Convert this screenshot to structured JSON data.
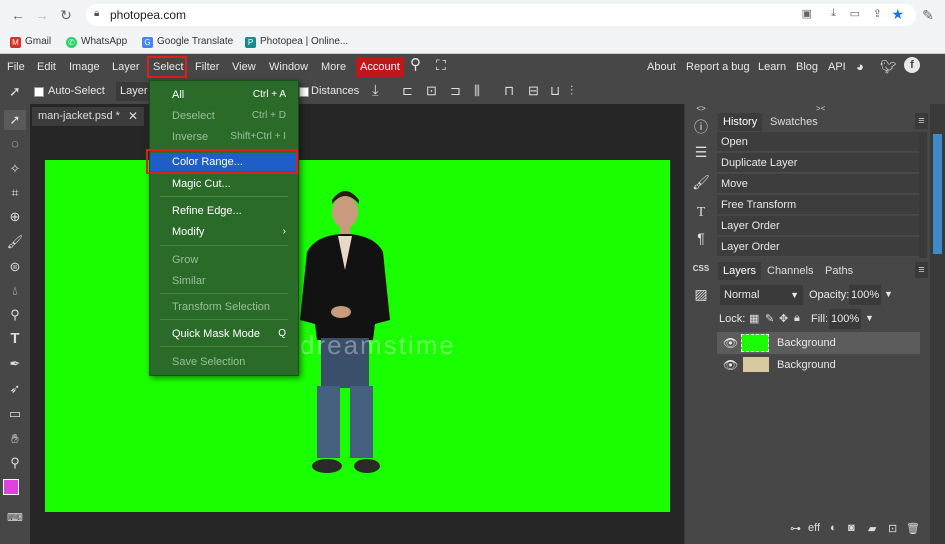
{
  "browser": {
    "url": "photopea.com",
    "bookmarks": [
      {
        "label": "Gmail",
        "color": "#d93025"
      },
      {
        "label": "WhatsApp",
        "color": "#25d366"
      },
      {
        "label": "Google Translate",
        "color": "#4285f4"
      },
      {
        "label": "Photopea | Online...",
        "color": "#1b8a8a"
      }
    ]
  },
  "menubar": {
    "items": [
      "File",
      "Edit",
      "Image",
      "Layer",
      "Select",
      "Filter",
      "View",
      "Window",
      "More",
      "Account"
    ],
    "right_items": [
      "About",
      "Report a bug",
      "Learn",
      "Blog",
      "API"
    ],
    "account_color": "#c0171a"
  },
  "options_bar": {
    "auto_select_label": "Auto-Select",
    "layer_value": "Layer",
    "distances_label": "Distances"
  },
  "document": {
    "tab_title": "man-jacket.psd *",
    "canvas_color": "#1aff00",
    "watermark": "dreamstime"
  },
  "select_menu": {
    "items": [
      {
        "label": "All",
        "shortcut": "Ctrl + A",
        "disabled": false
      },
      {
        "label": "Deselect",
        "shortcut": "Ctrl + D",
        "disabled": true
      },
      {
        "label": "Inverse",
        "shortcut": "Shift+Ctrl + I",
        "disabled": true
      },
      {
        "label": "Color Range...",
        "shortcut": "",
        "disabled": false,
        "highlighted": true
      },
      {
        "label": "Magic Cut...",
        "shortcut": "",
        "disabled": false
      },
      {
        "label": "Refine Edge...",
        "shortcut": "",
        "disabled": false
      },
      {
        "label": "Modify",
        "shortcut": "›",
        "disabled": false
      },
      {
        "label": "Grow",
        "shortcut": "",
        "disabled": true
      },
      {
        "label": "Similar",
        "shortcut": "",
        "disabled": true
      },
      {
        "label": "Transform Selection",
        "shortcut": "",
        "disabled": true
      },
      {
        "label": "Quick Mask Mode",
        "shortcut": "Q",
        "disabled": false
      },
      {
        "label": "Save Selection",
        "shortcut": "",
        "disabled": true
      }
    ]
  },
  "history_panel": {
    "tabs": [
      "History",
      "Swatches"
    ],
    "entries": [
      "Open",
      "Duplicate Layer",
      "Move",
      "Free Transform",
      "Layer Order",
      "Layer Order"
    ]
  },
  "layers_panel": {
    "tabs": [
      "Layers",
      "Channels",
      "Paths"
    ],
    "blend_mode": "Normal",
    "opacity_label": "Opacity:",
    "opacity_value": "100%",
    "lock_label": "Lock:",
    "fill_label": "Fill:",
    "fill_value": "100%",
    "layers": [
      {
        "name": "Background",
        "selected": true
      },
      {
        "name": "Background",
        "selected": false
      }
    ],
    "footer_label": "eff"
  }
}
